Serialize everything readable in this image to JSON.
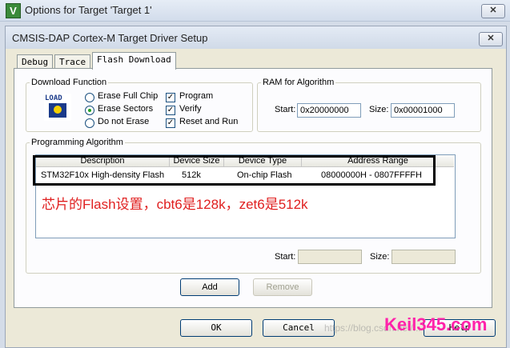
{
  "outer_window": {
    "title": "Options for Target 'Target 1'",
    "app_icon_letter": "V",
    "close": "✕"
  },
  "dialog": {
    "title": "CMSIS-DAP Cortex-M Target Driver Setup",
    "close": "✕",
    "tabs": [
      {
        "label": "Debug",
        "active": false
      },
      {
        "label": "Trace",
        "active": false
      },
      {
        "label": "Flash Download",
        "active": true
      }
    ]
  },
  "download_function": {
    "legend": "Download Function",
    "load_icon_text": "LOAD",
    "erase_options": [
      {
        "label": "Erase Full Chip",
        "selected": false
      },
      {
        "label": "Erase Sectors",
        "selected": true
      },
      {
        "label": "Do not Erase",
        "selected": false
      }
    ],
    "checks": [
      {
        "label": "Program",
        "checked": true
      },
      {
        "label": "Verify",
        "checked": true
      },
      {
        "label": "Reset and Run",
        "checked": true
      }
    ]
  },
  "ram_for_algorithm": {
    "legend": "RAM for Algorithm",
    "start_label": "Start:",
    "start_value": "0x20000000",
    "size_label": "Size:",
    "size_value": "0x00001000"
  },
  "programming_algorithm": {
    "legend": "Programming Algorithm",
    "columns": [
      "Description",
      "Device Size",
      "Device Type",
      "Address Range"
    ],
    "rows": [
      {
        "description": "STM32F10x High-density Flash",
        "device_size": "512k",
        "device_type": "On-chip Flash",
        "address_range": "08000000H - 0807FFFFH"
      }
    ],
    "start_label": "Start:",
    "start_value": "",
    "size_label": "Size:",
    "size_value": ""
  },
  "buttons": {
    "add": "Add",
    "remove": "Remove",
    "ok": "OK",
    "cancel": "Cancel",
    "help": "Help"
  },
  "annotation": "芯片的Flash设置，cbt6是128k，zet6是512k",
  "watermark": {
    "url": "https://blog.csdn.net/...",
    "brand": "Keil345.com"
  },
  "colors": {
    "annotation": "#e02020",
    "brand_watermark": "#ff22aa",
    "dialog_bg": "#ece9d8"
  }
}
